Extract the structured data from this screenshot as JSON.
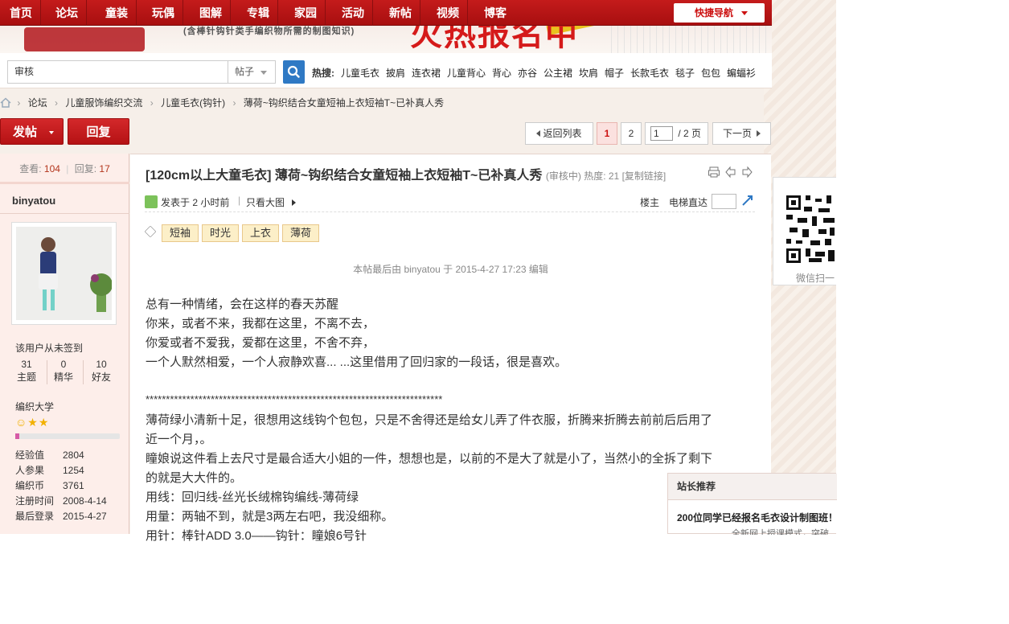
{
  "nav": {
    "items": [
      "首页",
      "论坛",
      "童装",
      "玩偶",
      "图解",
      "专辑",
      "家园",
      "活动",
      "新帖",
      "视频",
      "博客"
    ],
    "quick_nav": "快捷导航"
  },
  "banner": {
    "subtitle": "(含棒针钩针类手编织物所需的制图知识)",
    "headline": "火热报名中"
  },
  "search": {
    "value": "审核",
    "type": "帖子",
    "hot_label": "热搜:",
    "hot": [
      "儿童毛衣",
      "披肩",
      "连衣裙",
      "儿童背心",
      "背心",
      "亦谷",
      "公主裙",
      "坎肩",
      "帽子",
      "长款毛衣",
      "毯子",
      "包包",
      "蝙蝠衫"
    ]
  },
  "breadcrumb": {
    "items": [
      "论坛",
      "儿童服饰编织交流",
      "儿童毛衣(钩针)",
      "薄荷~钩织结合女童短袖上衣短袖T~已补真人秀"
    ],
    "separator": "›"
  },
  "actions": {
    "post": "发帖",
    "reply": "回复",
    "back": "返回列表",
    "page1": "1",
    "page2": "2",
    "page_input": "1",
    "total": "/ 2 页",
    "next": "下一页"
  },
  "sidebar": {
    "views_label": "查看:",
    "views": "104",
    "replies_label": "回复:",
    "replies": "17",
    "username": "binyatou",
    "signin": "该用户从未签到",
    "counts": [
      {
        "n": "31",
        "l": "主题"
      },
      {
        "n": "0",
        "l": "精华"
      },
      {
        "n": "10",
        "l": "好友"
      }
    ],
    "group": "编织大学",
    "progress": 0.04,
    "info": [
      {
        "k": "经验值",
        "v": "2804"
      },
      {
        "k": "人参果",
        "v": "1254"
      },
      {
        "k": "编织币",
        "v": "3761"
      },
      {
        "k": "注册时间",
        "v": "2008-4-14"
      },
      {
        "k": "最后登录",
        "v": "2015-4-27"
      }
    ]
  },
  "post": {
    "title": "[120cm以上大童毛衣] 薄荷~钩织结合女童短袖上衣短袖T~已补真人秀",
    "status": "(审核中)",
    "heat": "热度: 21",
    "copy_link": "[复制链接]",
    "posted": "发表于 2 小时前",
    "sep": "|",
    "only_image": "只看大图",
    "floor": "楼主",
    "elevator": "电梯直达",
    "tags": [
      "短袖",
      "时光",
      "上衣",
      "薄荷"
    ],
    "edited": "本帖最后由 binyatou 于 2015-4-27 17:23 编辑",
    "lines": [
      "总有一种情绪，会在这样的春天苏醒",
      "你来，或者不来，我都在这里，不离不去，",
      "你爱或者不爱我，爱都在这里，不舍不弃，",
      "一个人默然相爱，一个人寂静欢喜... ...这里借用了回归家的一段话，很是喜欢。",
      "*************************************************************************",
      "薄荷绿小清新十足，很想用这线钩个包包，只是不舍得还是给女儿弄了件衣服，折腾来折腾去前前后后用了",
      "近一个月，。",
      "瞳娘说这件看上去尺寸是最合适大小姐的一件，想想也是，以前的不是大了就是小了，当然小的全拆了剩下",
      "的就是大大件的。",
      "用线：回归线-丝光长绒棉钩编线-薄荷绿",
      "用量：两轴不到，就是3两左右吧，我没细称。",
      "用针：棒针ADD 3.0——钩针：瞳娘6号针"
    ]
  },
  "right": {
    "qr_caption": "微信扫一",
    "rec_title": "站长推荐",
    "rec_item": "200位同学已经报名毛衣设计制图班！",
    "rec_sub": "全新网上授课模式，突破"
  },
  "colors": {
    "accent": "#b3161c",
    "link_blue": "#2f79c4",
    "tag_bg": "#fcefc8"
  }
}
